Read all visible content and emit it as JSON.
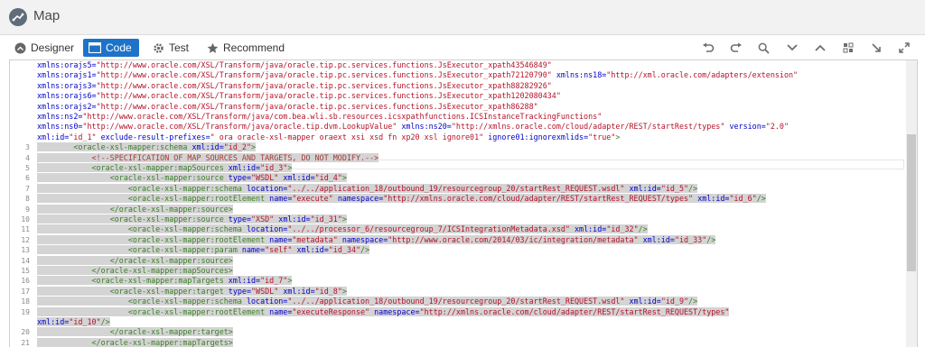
{
  "header": {
    "title": "Map"
  },
  "tabs": [
    {
      "label": "Designer",
      "icon": "designer-icon",
      "active": false
    },
    {
      "label": "Code",
      "icon": "code-icon",
      "active": true
    },
    {
      "label": "Test",
      "icon": "gear-icon",
      "active": false
    },
    {
      "label": "Recommend",
      "icon": "star-icon",
      "active": false
    }
  ],
  "toolbar_icons": [
    "undo-icon",
    "redo-icon",
    "search-icon",
    "chevron-down-icon",
    "chevron-up-icon",
    "format-icon",
    "collapse-icon",
    "expand-icon"
  ],
  "colors": {
    "accent": "#1e73c8",
    "tag": "#3a7f26",
    "attr": "#0000cc",
    "value": "#b5122a"
  },
  "lines": [
    {
      "n": "",
      "segs": [
        [
          "a",
          "xmlns:orajs5="
        ],
        [
          "v",
          "\"http://www.oracle.com/XSL/Transform/java/oracle.tip.pc.services.functions.JsExecutor_xpath43546849\""
        ]
      ]
    },
    {
      "n": "",
      "segs": [
        [
          "a",
          "xmlns:orajs1="
        ],
        [
          "v",
          "\"http://www.oracle.com/XSL/Transform/java/oracle.tip.pc.services.functions.JsExecutor_xpath72120790\""
        ],
        [
          "p",
          " "
        ],
        [
          "a",
          "xmlns:ns18="
        ],
        [
          "v",
          "\"http://xml.oracle.com/adapters/extension\""
        ]
      ]
    },
    {
      "n": "",
      "segs": [
        [
          "a",
          "xmlns:orajs3="
        ],
        [
          "v",
          "\"http://www.oracle.com/XSL/Transform/java/oracle.tip.pc.services.functions.JsExecutor_xpath88282926\""
        ]
      ]
    },
    {
      "n": "",
      "segs": [
        [
          "a",
          "xmlns:orajs6="
        ],
        [
          "v",
          "\"http://www.oracle.com/XSL/Transform/java/oracle.tip.pc.services.functions.JsExecutor_xpath1202080434\""
        ]
      ]
    },
    {
      "n": "",
      "segs": [
        [
          "a",
          "xmlns:orajs2="
        ],
        [
          "v",
          "\"http://www.oracle.com/XSL/Transform/java/oracle.tip.pc.services.functions.JsExecutor_xpath86288\""
        ]
      ]
    },
    {
      "n": "",
      "segs": [
        [
          "a",
          "xmlns:ns2="
        ],
        [
          "v",
          "\"http://www.oracle.com/XSL/Transform/java/com.bea.wli.sb.resources.icsxpathfunctions.ICSInstanceTrackingFunctions\""
        ]
      ]
    },
    {
      "n": "",
      "segs": [
        [
          "a",
          "xmlns:ns0="
        ],
        [
          "v",
          "\"http://www.oracle.com/XSL/Transform/java/oracle.tip.dvm.LookupValue\""
        ],
        [
          "p",
          " "
        ],
        [
          "a",
          "xmlns:ns20="
        ],
        [
          "v",
          "\"http://xmlns.oracle.com/cloud/adapter/REST/startRest/types\""
        ],
        [
          "p",
          " "
        ],
        [
          "a",
          "version="
        ],
        [
          "v",
          "\"2.0\""
        ]
      ]
    },
    {
      "n": "",
      "segs": [
        [
          "a",
          "xml:id="
        ],
        [
          "v",
          "\"id_1\""
        ],
        [
          "p",
          " "
        ],
        [
          "a",
          "exclude-result-prefixes="
        ],
        [
          "v",
          "\" ora oracle-xsl-mapper oraext xsi xsd fn xp20 xsl ignore01\""
        ],
        [
          "p",
          " "
        ],
        [
          "a",
          "ignore01:ignorexmlids="
        ],
        [
          "v",
          "\"true\""
        ],
        [
          "t",
          ">"
        ]
      ]
    },
    {
      "n": "3",
      "segs": [
        [
          "p",
          "        "
        ],
        [
          "t",
          "<oracle-xsl-mapper:schema"
        ],
        [
          "p",
          " "
        ],
        [
          "a",
          "xml:id="
        ],
        [
          "v",
          "\"id_2\""
        ],
        [
          "t",
          ">"
        ]
      ]
    },
    {
      "n": "4",
      "segs": [
        [
          "p",
          "            "
        ],
        [
          "c",
          "<!--SPECIFICATION OF MAP SOURCES AND TARGETS, DO NOT MODIFY.-->"
        ]
      ]
    },
    {
      "n": "5",
      "segs": [
        [
          "p",
          "            "
        ],
        [
          "t",
          "<oracle-xsl-mapper:mapSources"
        ],
        [
          "p",
          " "
        ],
        [
          "a",
          "xml:id="
        ],
        [
          "v",
          "\"id_3\""
        ],
        [
          "t",
          ">"
        ]
      ]
    },
    {
      "n": "6",
      "segs": [
        [
          "p",
          "                "
        ],
        [
          "t",
          "<oracle-xsl-mapper:source"
        ],
        [
          "p",
          " "
        ],
        [
          "a",
          "type="
        ],
        [
          "v",
          "\"WSDL\""
        ],
        [
          "p",
          " "
        ],
        [
          "a",
          "xml:id="
        ],
        [
          "v",
          "\"id_4\""
        ],
        [
          "t",
          ">"
        ]
      ]
    },
    {
      "n": "7",
      "segs": [
        [
          "p",
          "                    "
        ],
        [
          "t",
          "<oracle-xsl-mapper:schema"
        ],
        [
          "p",
          " "
        ],
        [
          "a",
          "location="
        ],
        [
          "v",
          "\"../../application_18/outbound_19/resourcegroup_20/startRest_REQUEST.wsdl\""
        ],
        [
          "p",
          " "
        ],
        [
          "a",
          "xml:id="
        ],
        [
          "v",
          "\"id_5\""
        ],
        [
          "t",
          "/>"
        ]
      ]
    },
    {
      "n": "8",
      "segs": [
        [
          "p",
          "                    "
        ],
        [
          "t",
          "<oracle-xsl-mapper:rootElement"
        ],
        [
          "p",
          " "
        ],
        [
          "a",
          "name="
        ],
        [
          "v",
          "\"execute\""
        ],
        [
          "p",
          " "
        ],
        [
          "a",
          "namespace="
        ],
        [
          "v",
          "\"http://xmlns.oracle.com/cloud/adapter/REST/startRest_REQUEST/types\""
        ],
        [
          "p",
          " "
        ],
        [
          "a",
          "xml:id="
        ],
        [
          "v",
          "\"id_6\""
        ],
        [
          "t",
          "/>"
        ]
      ]
    },
    {
      "n": "9",
      "segs": [
        [
          "p",
          "                "
        ],
        [
          "t",
          "</oracle-xsl-mapper:source>"
        ]
      ]
    },
    {
      "n": "10",
      "segs": [
        [
          "p",
          "                "
        ],
        [
          "t",
          "<oracle-xsl-mapper:source"
        ],
        [
          "p",
          " "
        ],
        [
          "a",
          "type="
        ],
        [
          "v",
          "\"XSD\""
        ],
        [
          "p",
          " "
        ],
        [
          "a",
          "xml:id="
        ],
        [
          "v",
          "\"id_31\""
        ],
        [
          "t",
          ">"
        ]
      ]
    },
    {
      "n": "11",
      "segs": [
        [
          "p",
          "                    "
        ],
        [
          "t",
          "<oracle-xsl-mapper:schema"
        ],
        [
          "p",
          " "
        ],
        [
          "a",
          "location="
        ],
        [
          "v",
          "\"../../processor_6/resourcegroup_7/ICSIntegrationMetadata.xsd\""
        ],
        [
          "p",
          " "
        ],
        [
          "a",
          "xml:id="
        ],
        [
          "v",
          "\"id_32\""
        ],
        [
          "t",
          "/>"
        ]
      ]
    },
    {
      "n": "12",
      "segs": [
        [
          "p",
          "                    "
        ],
        [
          "t",
          "<oracle-xsl-mapper:rootElement"
        ],
        [
          "p",
          " "
        ],
        [
          "a",
          "name="
        ],
        [
          "v",
          "\"metadata\""
        ],
        [
          "p",
          " "
        ],
        [
          "a",
          "namespace="
        ],
        [
          "v",
          "\"http://www.oracle.com/2014/03/ic/integration/metadata\""
        ],
        [
          "p",
          " "
        ],
        [
          "a",
          "xml:id="
        ],
        [
          "v",
          "\"id_33\""
        ],
        [
          "t",
          "/>"
        ]
      ]
    },
    {
      "n": "13",
      "segs": [
        [
          "p",
          "                    "
        ],
        [
          "t",
          "<oracle-xsl-mapper:param"
        ],
        [
          "p",
          " "
        ],
        [
          "a",
          "name="
        ],
        [
          "v",
          "\"self\""
        ],
        [
          "p",
          " "
        ],
        [
          "a",
          "xml:id="
        ],
        [
          "v",
          "\"id_34\""
        ],
        [
          "t",
          "/>"
        ]
      ]
    },
    {
      "n": "14",
      "segs": [
        [
          "p",
          "                "
        ],
        [
          "t",
          "</oracle-xsl-mapper:source>"
        ]
      ]
    },
    {
      "n": "15",
      "segs": [
        [
          "p",
          "            "
        ],
        [
          "t",
          "</oracle-xsl-mapper:mapSources>"
        ]
      ]
    },
    {
      "n": "16",
      "segs": [
        [
          "p",
          "            "
        ],
        [
          "t",
          "<oracle-xsl-mapper:mapTargets"
        ],
        [
          "p",
          " "
        ],
        [
          "a",
          "xml:id="
        ],
        [
          "v",
          "\"id_7\""
        ],
        [
          "t",
          ">"
        ]
      ]
    },
    {
      "n": "17",
      "segs": [
        [
          "p",
          "                "
        ],
        [
          "t",
          "<oracle-xsl-mapper:target"
        ],
        [
          "p",
          " "
        ],
        [
          "a",
          "type="
        ],
        [
          "v",
          "\"WSDL\""
        ],
        [
          "p",
          " "
        ],
        [
          "a",
          "xml:id="
        ],
        [
          "v",
          "\"id_8\""
        ],
        [
          "t",
          ">"
        ]
      ]
    },
    {
      "n": "18",
      "segs": [
        [
          "p",
          "                    "
        ],
        [
          "t",
          "<oracle-xsl-mapper:schema"
        ],
        [
          "p",
          " "
        ],
        [
          "a",
          "location="
        ],
        [
          "v",
          "\"../../application_18/outbound_19/resourcegroup_20/startRest_REQUEST.wsdl\""
        ],
        [
          "p",
          " "
        ],
        [
          "a",
          "xml:id="
        ],
        [
          "v",
          "\"id_9\""
        ],
        [
          "t",
          "/>"
        ]
      ]
    },
    {
      "n": "19",
      "segs": [
        [
          "p",
          "                    "
        ],
        [
          "t",
          "<oracle-xsl-mapper:rootElement"
        ],
        [
          "p",
          " "
        ],
        [
          "a",
          "name="
        ],
        [
          "v",
          "\"executeResponse\""
        ],
        [
          "p",
          " "
        ],
        [
          "a",
          "namespace="
        ],
        [
          "v",
          "\"http://xmlns.oracle.com/cloud/adapter/REST/startRest_REQUEST/types\""
        ]
      ]
    },
    {
      "n": "",
      "segs": [
        [
          "a",
          "xml:id="
        ],
        [
          "v",
          "\"id_10\""
        ],
        [
          "t",
          "/>"
        ]
      ]
    },
    {
      "n": "20",
      "segs": [
        [
          "p",
          "                "
        ],
        [
          "t",
          "</oracle-xsl-mapper:target>"
        ]
      ]
    },
    {
      "n": "21",
      "segs": [
        [
          "p",
          "            "
        ],
        [
          "t",
          "</oracle-xsl-mapper:mapTargets>"
        ]
      ]
    }
  ]
}
